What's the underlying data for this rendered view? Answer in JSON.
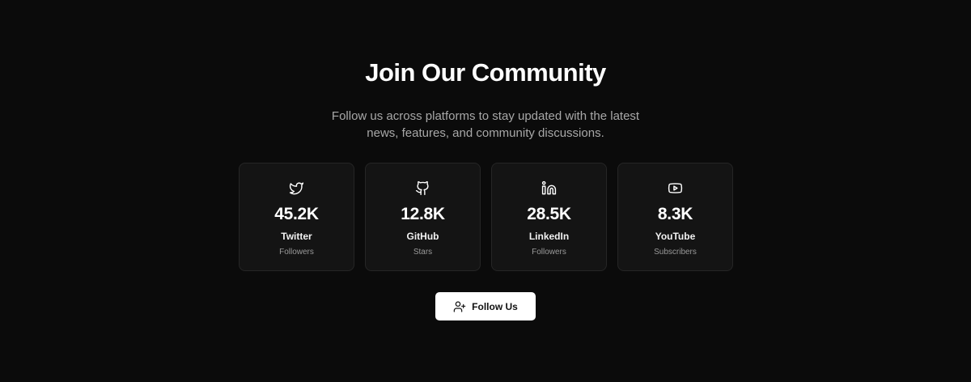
{
  "header": {
    "title": "Join Our Community",
    "subtitle": "Follow us across platforms to stay updated with the latest news, features, and community discussions."
  },
  "stats": [
    {
      "icon": "twitter-icon",
      "count": "45.2K",
      "platform": "Twitter",
      "metric": "Followers"
    },
    {
      "icon": "github-icon",
      "count": "12.8K",
      "platform": "GitHub",
      "metric": "Stars"
    },
    {
      "icon": "linkedin-icon",
      "count": "28.5K",
      "platform": "LinkedIn",
      "metric": "Followers"
    },
    {
      "icon": "youtube-icon",
      "count": "8.3K",
      "platform": "YouTube",
      "metric": "Subscribers"
    }
  ],
  "cta": {
    "label": "Follow Us",
    "icon": "user-plus-icon"
  },
  "colors": {
    "background": "#0b0b0b",
    "card": "#141414",
    "card_border": "#262626",
    "button": "#ffffff"
  }
}
